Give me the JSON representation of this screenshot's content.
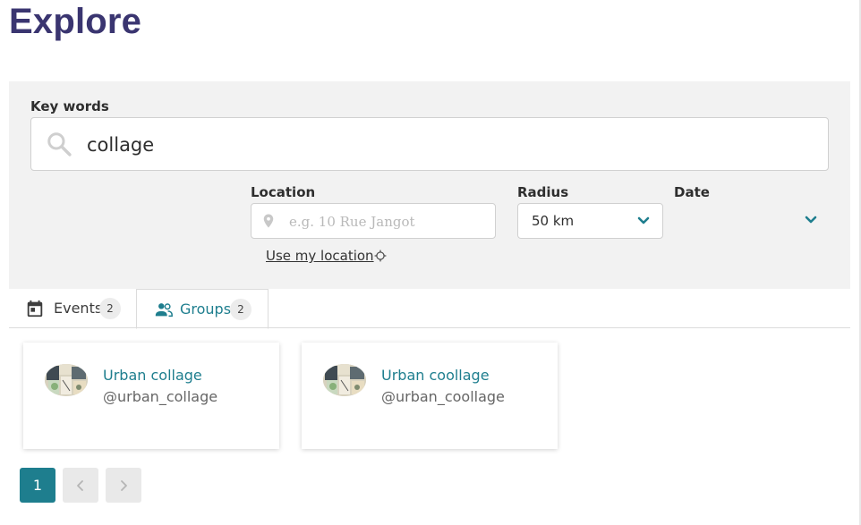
{
  "page": {
    "title": "Explore"
  },
  "search": {
    "keywords_label": "Key words",
    "keywords_value": "collage",
    "location_label": "Location",
    "location_placeholder": "e.g. 10 Rue Jangot",
    "location_value": "",
    "use_my_location": "Use my location",
    "radius_label": "Radius",
    "radius_value": "50 km",
    "date_label": "Date",
    "date_value": ""
  },
  "tabs": [
    {
      "label": "Events",
      "count": "2",
      "active": false
    },
    {
      "label": "Groups",
      "count": "2",
      "active": true
    }
  ],
  "groups": [
    {
      "name": "Urban collage",
      "handle": "@urban_collage"
    },
    {
      "name": "Urban coollage",
      "handle": "@urban_coollage"
    }
  ],
  "pagination": {
    "current": "1"
  },
  "colors": {
    "title": "#3a3570",
    "accent": "#1e7e8e",
    "panel": "#f2f2f2"
  },
  "icons": [
    "search-icon",
    "map-marker-icon",
    "crosshair-icon",
    "chevron-down-icon",
    "calendar-icon",
    "account-group-icon",
    "chevron-left-icon",
    "chevron-right-icon"
  ]
}
